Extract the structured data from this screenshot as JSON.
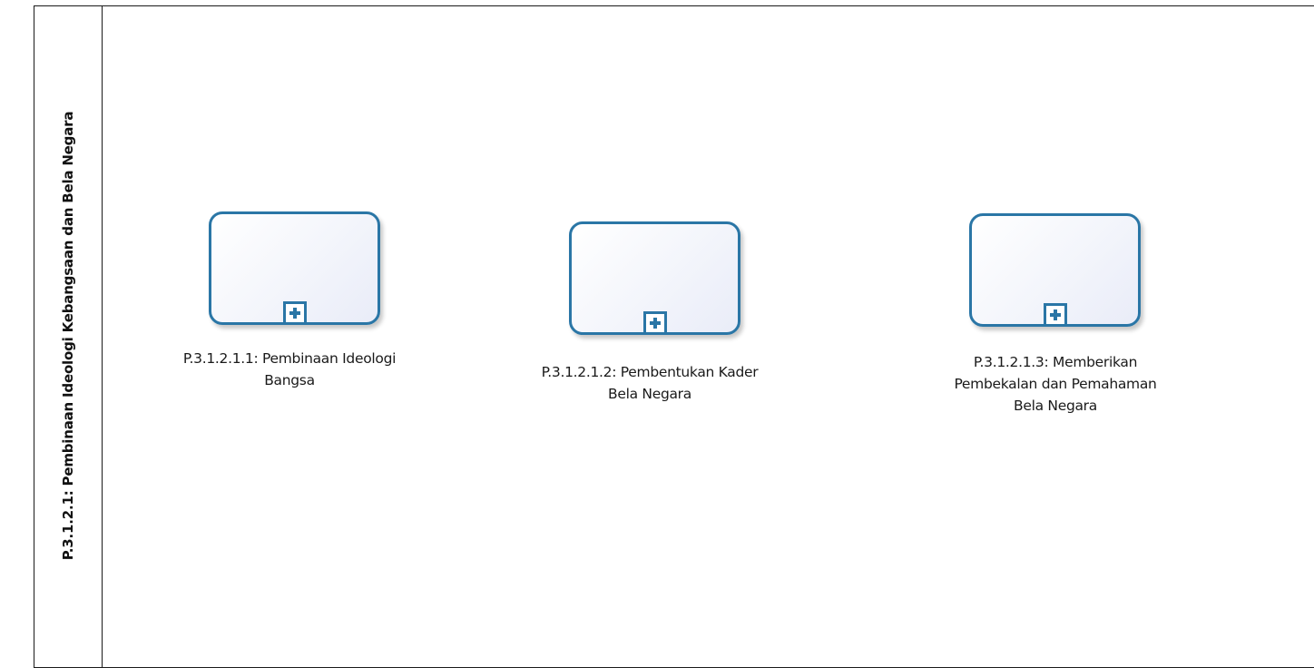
{
  "pool": {
    "label": "P.3.1.2.1: Pembinaan Ideologi Kebangsaan dan Bela Negara"
  },
  "tasks": [
    {
      "line1": "P.3.1.2.1.1: Pembinaan Ideologi",
      "line2": "Bangsa",
      "line3": "",
      "marker_icon": "collapsed-subprocess-plus-icon"
    },
    {
      "line1": "P.3.1.2.1.2: Pembentukan Kader",
      "line2": "Bela Negara",
      "line3": "",
      "marker_icon": "collapsed-subprocess-plus-icon"
    },
    {
      "line1": "P.3.1.2.1.3: Memberikan",
      "line2": "Pembekalan dan Pemahaman",
      "line3": "Bela Negara",
      "marker_icon": "collapsed-subprocess-plus-icon"
    }
  ],
  "colors": {
    "task_border": "#2a76a6",
    "pool_border": "#1a1a1a",
    "text": "#1a1a1a"
  }
}
